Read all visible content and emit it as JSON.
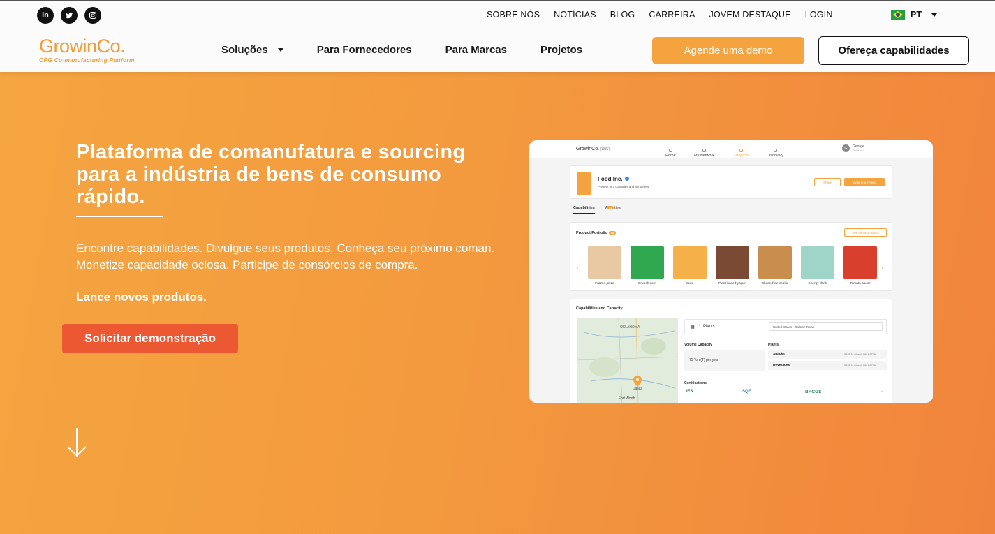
{
  "topbar": {
    "social": [
      {
        "name": "linkedin",
        "glyph": "in"
      },
      {
        "name": "twitter",
        "glyph": "🐦"
      },
      {
        "name": "instagram",
        "glyph": "◎"
      }
    ],
    "links": [
      "SOBRE NÓS",
      "NOTÍCIAS",
      "BLOG",
      "CARREIRA",
      "JOVEM DESTAQUE",
      "LOGIN"
    ],
    "language": "PT"
  },
  "nav": {
    "logo_text": "GrowinCo.",
    "logo_tagline": "CPG Co-manufacturing Platform.",
    "items": [
      "Soluções",
      "Para Fornecedores",
      "Para Marcas",
      "Projetos"
    ],
    "demo_button": "Agende uma demo",
    "offer_button": "Ofereça capabilidades",
    "colors": {
      "accent": "#f5a33e",
      "cta": "#ec5832"
    }
  },
  "hero": {
    "headline": "Plataforma de comanufatura e sourcing para a indústria de bens de consumo rápido.",
    "lead": "Encontre capabilidades. Divulgue seus produtos. Conheça seu próximo coman. Monetize capacidade ociosa. Participe de consórcios de compra.",
    "lead_strong": "Lance novos produtos.",
    "cta_button": "Solicitar demonstração"
  },
  "mockup": {
    "app_logo": "GrowinCo.",
    "app_logo_badge": "BETA",
    "tabs": [
      "Home",
      "My Network",
      "Projects",
      "Discovery"
    ],
    "user_initial": "G",
    "user_name": "George",
    "user_company": "Food Inc.",
    "company_name": "Food Inc.",
    "company_present": "Present in 3 countries and XX others.",
    "share_button": "Share",
    "invite_button": "Invite to a Project",
    "profile_tabs": [
      "Capabilities",
      "Activities"
    ],
    "activities_badge": "12",
    "portfolio_title": "Product Portfolio",
    "portfolio_badge": "48",
    "see_all": "See all 45 products",
    "products": [
      {
        "label": "Frozen pizza",
        "color": "#e9c9a3"
      },
      {
        "label": "Crunch corn",
        "color": "#2fa84f"
      },
      {
        "label": "Juice",
        "color": "#f5b04a"
      },
      {
        "label": "Plant-based yogurt",
        "color": "#7a4a34"
      },
      {
        "label": "Gluten-free cookie",
        "color": "#c98e4e"
      },
      {
        "label": "Energy drink",
        "color": "#9fd4c9"
      },
      {
        "label": "Tomato sauce",
        "color": "#d8402d"
      }
    ],
    "capacity_title": "Capabilities and Capacity",
    "plants_count": "3",
    "plants_label": "Plants",
    "location_select": "United States • Dallas / Texas",
    "volume_title": "Volume Capacity",
    "volume_value": "75 Ton (T) per year",
    "plants_title": "Plants",
    "plants": [
      {
        "name": "Snacks",
        "address": "5321 N Street, OK 84739"
      },
      {
        "name": "Beverages",
        "address": "5321 N Street, OK 84739"
      }
    ],
    "certifications_title": "Certifications",
    "certifications": [
      "IFS",
      "SQF",
      "BRCGS"
    ],
    "map_labels": [
      "OKLAHOMA",
      "Dallas",
      "Fort Worth"
    ]
  }
}
